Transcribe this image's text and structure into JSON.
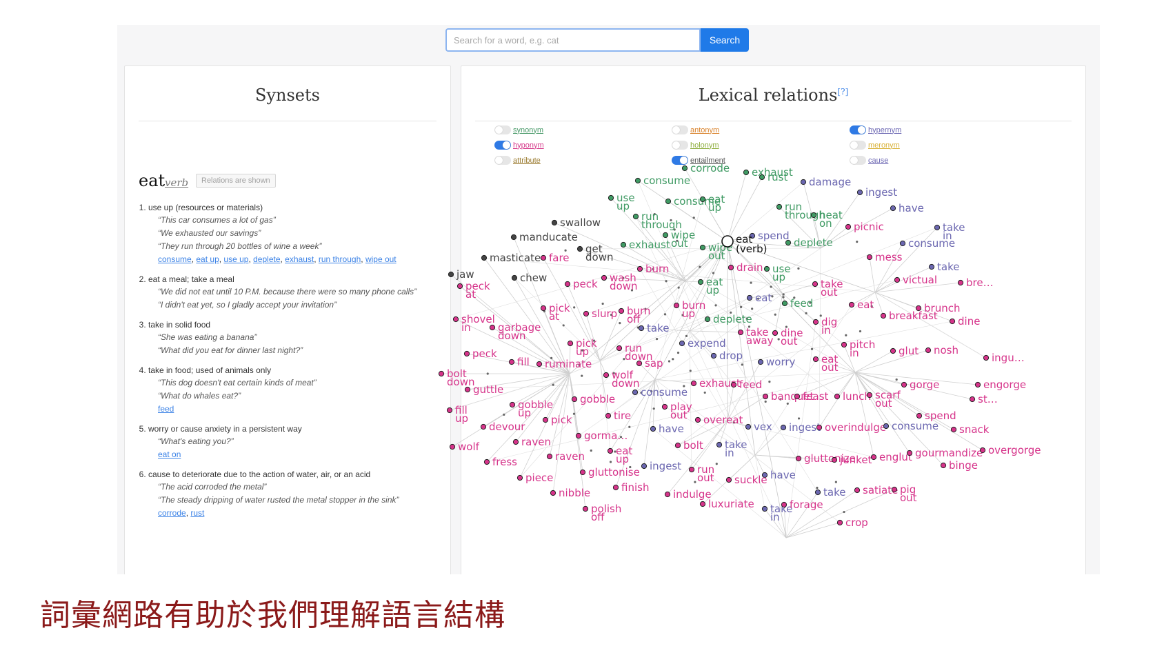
{
  "search": {
    "placeholder": "Search for a word, e.g. cat",
    "button_label": "Search"
  },
  "synsets_panel": {
    "title": "Synsets",
    "word": "eat",
    "pos": "verb",
    "badge": "Relations are shown",
    "senses": [
      {
        "definition": "use up (resources or materials)",
        "examples": [
          "“This car consumes a lot of gas”",
          "“We exhausted our savings”",
          "“They run through 20 bottles of wine a week”"
        ],
        "links": [
          "consume",
          "eat up",
          "use up",
          "deplete",
          "exhaust",
          "run through",
          "wipe out"
        ]
      },
      {
        "definition": "eat a meal; take a meal",
        "examples": [
          "“We did not eat until 10 P.M. because there were so many phone calls”",
          "“I didn't eat yet, so I gladly accept your invitation”"
        ],
        "links": []
      },
      {
        "definition": "take in solid food",
        "examples": [
          "“She was eating a banana”",
          "“What did you eat for dinner last night?”"
        ],
        "links": []
      },
      {
        "definition": "take in food; used of animals only",
        "examples": [
          "“This dog doesn't eat certain kinds of meat”",
          "“What do whales eat?”"
        ],
        "links": [
          "feed"
        ]
      },
      {
        "definition": "worry or cause anxiety in a persistent way",
        "examples": [
          "“What's eating you?”"
        ],
        "links": [
          "eat on"
        ]
      },
      {
        "definition": "cause to deteriorate due to the action of water, air, or an acid",
        "examples": [
          "“The acid corroded the metal”",
          "“The steady dripping of water rusted the metal stopper in the sink”"
        ],
        "links": [
          "corrode",
          "rust"
        ]
      }
    ]
  },
  "relations_panel": {
    "title": "Lexical relations",
    "help": "[?]",
    "toggles": [
      {
        "label": "synonym",
        "on": false,
        "color": "#4a9a6a"
      },
      {
        "label": "antonym",
        "on": false,
        "color": "#d9822b"
      },
      {
        "label": "hypernym",
        "on": true,
        "color": "#6e69b4"
      },
      {
        "label": "hyponym",
        "on": true,
        "color": "#d6398a"
      },
      {
        "label": "holonym",
        "on": false,
        "color": "#8fae3e"
      },
      {
        "label": "meronym",
        "on": false,
        "color": "#d9b23a"
      },
      {
        "label": "attribute",
        "on": false,
        "color": "#9a7a2e"
      },
      {
        "label": "entailment",
        "on": true,
        "color": "#555555"
      },
      {
        "label": "cause",
        "on": false,
        "color": "#6e69b4"
      }
    ],
    "graph": {
      "root": [
        "eat",
        "(verb)"
      ],
      "colors": {
        "syn": "#3f9a63",
        "hyper": "#6b67b0",
        "hypo": "#d6338a",
        "ent": "#444444"
      },
      "nodes": [
        {
          "label": "corrode",
          "kind": "syn"
        },
        {
          "label": "exhaust",
          "kind": "syn"
        },
        {
          "label": "rust",
          "kind": "syn"
        },
        {
          "label": "damage",
          "kind": "hyper"
        },
        {
          "label": "ingest",
          "kind": "hyper"
        },
        {
          "label": "have",
          "kind": "hyper"
        },
        {
          "label": "take in",
          "kind": "hyper"
        },
        {
          "label": "consume",
          "kind": "hyper"
        },
        {
          "label": "take",
          "kind": "hyper"
        },
        {
          "label": "consume",
          "kind": "syn"
        },
        {
          "label": "use up",
          "kind": "syn"
        },
        {
          "label": "consume",
          "kind": "syn"
        },
        {
          "label": "eat up",
          "kind": "syn"
        },
        {
          "label": "run through",
          "kind": "syn"
        },
        {
          "label": "heat on",
          "kind": "syn"
        },
        {
          "label": "run through",
          "kind": "syn"
        },
        {
          "label": "swallow",
          "kind": "ent"
        },
        {
          "label": "manducate",
          "kind": "ent"
        },
        {
          "label": "get down",
          "kind": "ent"
        },
        {
          "label": "exhaust",
          "kind": "syn"
        },
        {
          "label": "wipe out",
          "kind": "syn"
        },
        {
          "label": "wipe out",
          "kind": "syn"
        },
        {
          "label": "spend",
          "kind": "hyper"
        },
        {
          "label": "deplete",
          "kind": "syn"
        },
        {
          "label": "masticate",
          "kind": "ent"
        },
        {
          "label": "fare",
          "kind": "hypo"
        },
        {
          "label": "jaw",
          "kind": "ent"
        },
        {
          "label": "chew",
          "kind": "ent"
        },
        {
          "label": "peck",
          "kind": "hypo"
        },
        {
          "label": "wash down",
          "kind": "hypo"
        },
        {
          "label": "burn",
          "kind": "hypo"
        },
        {
          "label": "drain",
          "kind": "hypo"
        },
        {
          "label": "use up",
          "kind": "syn"
        },
        {
          "label": "eat up",
          "kind": "syn"
        },
        {
          "label": "picnic",
          "kind": "hypo"
        },
        {
          "label": "mess",
          "kind": "hypo"
        },
        {
          "label": "victual",
          "kind": "hypo"
        },
        {
          "label": "bre…",
          "kind": "hypo"
        },
        {
          "label": "peck at",
          "kind": "hypo"
        },
        {
          "label": "shovel in",
          "kind": "hypo"
        },
        {
          "label": "pick at",
          "kind": "hypo"
        },
        {
          "label": "garbage down",
          "kind": "hypo"
        },
        {
          "label": "slurp",
          "kind": "hypo"
        },
        {
          "label": "burn off",
          "kind": "hypo"
        },
        {
          "label": "burn up",
          "kind": "hypo"
        },
        {
          "label": "eat",
          "kind": "hyper"
        },
        {
          "label": "feed",
          "kind": "syn"
        },
        {
          "label": "take out",
          "kind": "hypo"
        },
        {
          "label": "eat",
          "kind": "hypo"
        },
        {
          "label": "brunch",
          "kind": "hypo"
        },
        {
          "label": "breakfast",
          "kind": "hypo"
        },
        {
          "label": "dine",
          "kind": "hypo"
        },
        {
          "label": "take",
          "kind": "hyper"
        },
        {
          "label": "deplete",
          "kind": "syn"
        },
        {
          "label": "dig in",
          "kind": "hypo"
        },
        {
          "label": "take away",
          "kind": "hypo"
        },
        {
          "label": "dine out",
          "kind": "hypo"
        },
        {
          "label": "expend",
          "kind": "hyper"
        },
        {
          "label": "pick up",
          "kind": "hypo"
        },
        {
          "label": "run down",
          "kind": "hypo"
        },
        {
          "label": "pitch in",
          "kind": "hypo"
        },
        {
          "label": "glut",
          "kind": "hypo"
        },
        {
          "label": "nosh",
          "kind": "hypo"
        },
        {
          "label": "ingu…",
          "kind": "hypo"
        },
        {
          "label": "peck",
          "kind": "hypo"
        },
        {
          "label": "fill",
          "kind": "hypo"
        },
        {
          "label": "ruminate",
          "kind": "hypo"
        },
        {
          "label": "sap",
          "kind": "hypo"
        },
        {
          "label": "drop",
          "kind": "hyper"
        },
        {
          "label": "worry",
          "kind": "hyper"
        },
        {
          "label": "eat out",
          "kind": "hypo"
        },
        {
          "label": "bolt down",
          "kind": "hypo"
        },
        {
          "label": "guttle",
          "kind": "hypo"
        },
        {
          "label": "wolf down",
          "kind": "hypo"
        },
        {
          "label": "exhaust",
          "kind": "hypo"
        },
        {
          "label": "feed",
          "kind": "hypo"
        },
        {
          "label": "gorge",
          "kind": "hypo"
        },
        {
          "label": "engorge",
          "kind": "hypo"
        },
        {
          "label": "consume",
          "kind": "hyper"
        },
        {
          "label": "banquet",
          "kind": "hypo"
        },
        {
          "label": "feast",
          "kind": "hypo"
        },
        {
          "label": "lunch",
          "kind": "hypo"
        },
        {
          "label": "scarf out",
          "kind": "hypo"
        },
        {
          "label": "st…",
          "kind": "hypo"
        },
        {
          "label": "fill up",
          "kind": "hypo"
        },
        {
          "label": "gobble up",
          "kind": "hypo"
        },
        {
          "label": "gobble",
          "kind": "hypo"
        },
        {
          "label": "play out",
          "kind": "hypo"
        },
        {
          "label": "overeat",
          "kind": "hypo"
        },
        {
          "label": "pick",
          "kind": "hypo"
        },
        {
          "label": "tire",
          "kind": "hypo"
        },
        {
          "label": "spend",
          "kind": "hypo"
        },
        {
          "label": "devour",
          "kind": "hypo"
        },
        {
          "label": "have",
          "kind": "hyper"
        },
        {
          "label": "vex",
          "kind": "hyper"
        },
        {
          "label": "ingest",
          "kind": "hyper"
        },
        {
          "label": "overindulge",
          "kind": "hypo"
        },
        {
          "label": "consume",
          "kind": "hyper"
        },
        {
          "label": "snack",
          "kind": "hypo"
        },
        {
          "label": "gorma…",
          "kind": "hypo"
        },
        {
          "label": "wolf",
          "kind": "hypo"
        },
        {
          "label": "raven",
          "kind": "hypo"
        },
        {
          "label": "bolt",
          "kind": "hypo"
        },
        {
          "label": "take in",
          "kind": "hyper"
        },
        {
          "label": "raven",
          "kind": "hypo"
        },
        {
          "label": "eat up",
          "kind": "hypo"
        },
        {
          "label": "gluttonize",
          "kind": "hypo"
        },
        {
          "label": "junket",
          "kind": "hypo"
        },
        {
          "label": "englut",
          "kind": "hypo"
        },
        {
          "label": "gourmandize",
          "kind": "hypo"
        },
        {
          "label": "overgorge",
          "kind": "hypo"
        },
        {
          "label": "fress",
          "kind": "hypo"
        },
        {
          "label": "binge",
          "kind": "hypo"
        },
        {
          "label": "ingest",
          "kind": "hyper"
        },
        {
          "label": "run out",
          "kind": "hypo"
        },
        {
          "label": "gluttonise",
          "kind": "hypo"
        },
        {
          "label": "have",
          "kind": "hyper"
        },
        {
          "label": "piece",
          "kind": "hypo"
        },
        {
          "label": "suckle",
          "kind": "hypo"
        },
        {
          "label": "finish",
          "kind": "hypo"
        },
        {
          "label": "take",
          "kind": "hyper"
        },
        {
          "label": "satiate",
          "kind": "hypo"
        },
        {
          "label": "pig out",
          "kind": "hypo"
        },
        {
          "label": "nibble",
          "kind": "hypo"
        },
        {
          "label": "indulge",
          "kind": "hypo"
        },
        {
          "label": "luxuriate",
          "kind": "hypo"
        },
        {
          "label": "take in",
          "kind": "hyper"
        },
        {
          "label": "forage",
          "kind": "hypo"
        },
        {
          "label": "polish off",
          "kind": "hypo"
        },
        {
          "label": "crop",
          "kind": "hypo"
        }
      ]
    }
  },
  "caption": "詞彙網路有助於我們理解語言結構"
}
